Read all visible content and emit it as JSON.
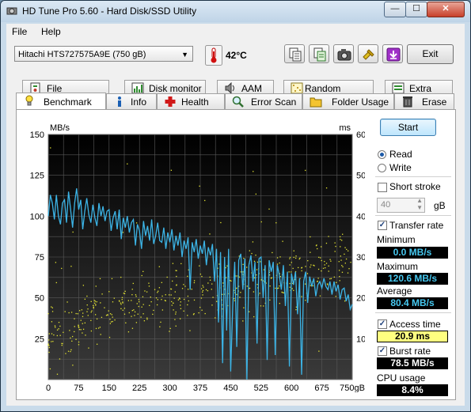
{
  "window": {
    "title": "HD Tune Pro 5.60 - Hard Disk/SSD Utility",
    "minimize": "—",
    "maximize": "☐",
    "close": "✕"
  },
  "menu": [
    "File",
    "Help"
  ],
  "toolbar": {
    "drive": "Hitachi HTS727575A9E (750 gB)",
    "temperature": "42°C",
    "exit_label": "Exit"
  },
  "tabs_row1": [
    "File Benchmark",
    "Disk monitor",
    "AAM",
    "Random Access",
    "Extra tests"
  ],
  "tabs_row2": [
    "Benchmark",
    "Info",
    "Health",
    "Error Scan",
    "Folder Usage",
    "Erase"
  ],
  "benchmark": {
    "start_label": "Start",
    "read_label": "Read",
    "write_label": "Write",
    "mode_selected": "Read",
    "short_stroke_label": "Short stroke",
    "short_stroke_checked": false,
    "short_stroke_value": "40",
    "short_stroke_unit": "gB",
    "transfer_rate_label": "Transfer rate",
    "transfer_rate_checked": true,
    "minimum_label": "Minimum",
    "minimum_value": "0.0 MB/s",
    "maximum_label": "Maximum",
    "maximum_value": "120.6 MB/s",
    "average_label": "Average",
    "average_value": "80.4 MB/s",
    "access_time_label": "Access time",
    "access_time_checked": true,
    "access_time_value": "20.9 ms",
    "burst_rate_label": "Burst rate",
    "burst_rate_checked": true,
    "burst_rate_value": "78.5 MB/s",
    "cpu_usage_label": "CPU usage",
    "cpu_usage_value": "8.4%"
  },
  "colors": {
    "transfer_line": "#3cb4e6",
    "access_points": "#e6e632",
    "plot_bg": "#000000",
    "grid": "#5a5a5a"
  },
  "chart_data": {
    "type": "line",
    "left_unit": "MB/s",
    "right_unit": "ms",
    "x_unit": "gB",
    "xlim": [
      0,
      750
    ],
    "ylim_left": [
      0,
      150
    ],
    "ylim_right": [
      0,
      60
    ],
    "x_ticks": [
      0,
      75,
      150,
      225,
      300,
      375,
      450,
      525,
      600,
      675,
      750
    ],
    "x_tick_labels": [
      "0",
      "75",
      "150",
      "225",
      "300",
      "375",
      "450",
      "525",
      "600",
      "675",
      "750gB"
    ],
    "y_left_ticks": [
      25,
      50,
      75,
      100,
      125,
      150
    ],
    "y_right_ticks": [
      10,
      20,
      30,
      40,
      50,
      60
    ],
    "series": [
      {
        "axis": "left",
        "points": [
          [
            0,
            100
          ],
          [
            5,
            113
          ],
          [
            10,
            108
          ],
          [
            15,
            98
          ],
          [
            20,
            113
          ],
          [
            25,
            100
          ],
          [
            30,
            95
          ],
          [
            35,
            108
          ],
          [
            40,
            110
          ],
          [
            45,
            96
          ],
          [
            50,
            115
          ],
          [
            55,
            104
          ],
          [
            60,
            93
          ],
          [
            65,
            108
          ],
          [
            70,
            117
          ],
          [
            75,
            104
          ],
          [
            80,
            110
          ],
          [
            85,
            92
          ],
          [
            90,
            103
          ],
          [
            95,
            111
          ],
          [
            100,
            101
          ],
          [
            105,
            96
          ],
          [
            110,
            107
          ],
          [
            115,
            99
          ],
          [
            120,
            94
          ],
          [
            125,
            108
          ],
          [
            130,
            100
          ],
          [
            135,
            106
          ],
          [
            140,
            97
          ],
          [
            145,
            103
          ],
          [
            150,
            104
          ],
          [
            155,
            91
          ],
          [
            160,
            99
          ],
          [
            165,
            103
          ],
          [
            170,
            92
          ],
          [
            175,
            104
          ],
          [
            180,
            86
          ],
          [
            185,
            99
          ],
          [
            190,
            93
          ],
          [
            195,
            100
          ],
          [
            200,
            90
          ],
          [
            205,
            96
          ],
          [
            210,
            98
          ],
          [
            215,
            82
          ],
          [
            220,
            95
          ],
          [
            225,
            91
          ],
          [
            230,
            80
          ],
          [
            235,
            97
          ],
          [
            240,
            88
          ],
          [
            245,
            94
          ],
          [
            250,
            85
          ],
          [
            255,
            98
          ],
          [
            260,
            83
          ],
          [
            265,
            88
          ],
          [
            270,
            96
          ],
          [
            275,
            85
          ],
          [
            280,
            84
          ],
          [
            285,
            93
          ],
          [
            290,
            80
          ],
          [
            295,
            90
          ],
          [
            300,
            84
          ],
          [
            305,
            92
          ],
          [
            310,
            79
          ],
          [
            315,
            88
          ],
          [
            320,
            82
          ],
          [
            325,
            90
          ],
          [
            330,
            75
          ],
          [
            335,
            85
          ],
          [
            340,
            80
          ],
          [
            345,
            87
          ],
          [
            350,
            55
          ],
          [
            355,
            84
          ],
          [
            360,
            78
          ],
          [
            365,
            86
          ],
          [
            370,
            74
          ],
          [
            375,
            82
          ],
          [
            380,
            77
          ],
          [
            385,
            85
          ],
          [
            390,
            70
          ],
          [
            395,
            81
          ],
          [
            400,
            76
          ],
          [
            405,
            83
          ],
          [
            410,
            60
          ],
          [
            415,
            80
          ],
          [
            420,
            35
          ],
          [
            425,
            78
          ],
          [
            430,
            10
          ],
          [
            435,
            75
          ],
          [
            440,
            30
          ],
          [
            445,
            80
          ],
          [
            450,
            5
          ],
          [
            455,
            45
          ],
          [
            460,
            72
          ],
          [
            465,
            20
          ],
          [
            470,
            73
          ],
          [
            475,
            77
          ],
          [
            480,
            55
          ],
          [
            485,
            74
          ],
          [
            490,
            0
          ],
          [
            495,
            70
          ],
          [
            500,
            76
          ],
          [
            505,
            60
          ],
          [
            510,
            72
          ],
          [
            515,
            22
          ],
          [
            520,
            74
          ],
          [
            525,
            75
          ],
          [
            530,
            50
          ],
          [
            535,
            70
          ],
          [
            540,
            12
          ],
          [
            545,
            73
          ],
          [
            550,
            66
          ],
          [
            555,
            72
          ],
          [
            560,
            15
          ],
          [
            565,
            70
          ],
          [
            570,
            64
          ],
          [
            575,
            55
          ],
          [
            580,
            70
          ],
          [
            585,
            45
          ],
          [
            590,
            66
          ],
          [
            595,
            8
          ],
          [
            600,
            65
          ],
          [
            605,
            58
          ],
          [
            610,
            66
          ],
          [
            615,
            40
          ],
          [
            620,
            62
          ],
          [
            625,
            3
          ],
          [
            630,
            60
          ],
          [
            635,
            66
          ],
          [
            640,
            47
          ],
          [
            645,
            63
          ],
          [
            650,
            57
          ],
          [
            655,
            62
          ],
          [
            660,
            51
          ],
          [
            665,
            58
          ],
          [
            670,
            60
          ],
          [
            675,
            56
          ],
          [
            680,
            62
          ],
          [
            685,
            57
          ],
          [
            690,
            55
          ],
          [
            695,
            60
          ],
          [
            700,
            52
          ],
          [
            705,
            60
          ],
          [
            710,
            54
          ],
          [
            715,
            58
          ],
          [
            720,
            49
          ],
          [
            725,
            55
          ],
          [
            730,
            56
          ],
          [
            735,
            48
          ],
          [
            740,
            52
          ],
          [
            745,
            43
          ],
          [
            750,
            46
          ]
        ]
      },
      {
        "axis": "right",
        "scatter": true,
        "trend": [
          [
            0,
            9
          ],
          [
            100,
            15
          ],
          [
            200,
            18
          ],
          [
            300,
            20
          ],
          [
            400,
            22
          ],
          [
            500,
            24
          ],
          [
            600,
            26
          ],
          [
            700,
            27
          ],
          [
            750,
            28
          ]
        ],
        "count": 520,
        "spread": 7
      }
    ]
  }
}
